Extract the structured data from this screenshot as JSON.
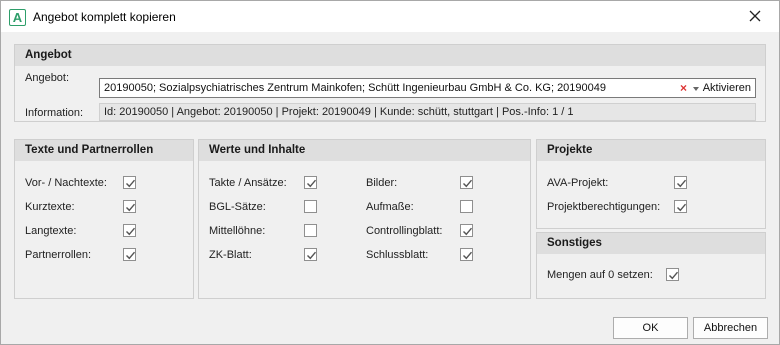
{
  "window": {
    "title": "Angebot komplett kopieren",
    "icon_letter": "A",
    "accent": "#2e9e6a"
  },
  "angebot": {
    "header": "Angebot",
    "angebot_label": "Angebot:",
    "angebot_value": "20190050; Sozialpsychiatrisches Zentrum Mainkofen; Schütt Ingenieurbau GmbH & Co. KG; 20190049",
    "activate_label": "Aktivieren",
    "information_label": "Information:",
    "information_value": "Id: 20190050 | Angebot: 20190050 | Projekt: 20190049 | Kunde: schütt, stuttgart | Pos.-Info: 1 / 1"
  },
  "texte": {
    "header": "Texte und Partnerrollen",
    "items": [
      {
        "label": "Vor- / Nachtexte:",
        "checked": true
      },
      {
        "label": "Kurztexte:",
        "checked": true
      },
      {
        "label": "Langtexte:",
        "checked": true
      },
      {
        "label": "Partnerrollen:",
        "checked": true
      }
    ]
  },
  "werte": {
    "header": "Werte und Inhalte",
    "left": [
      {
        "label": "Takte / Ansätze:",
        "checked": true
      },
      {
        "label": "BGL-Sätze:",
        "checked": false
      },
      {
        "label": "Mittellöhne:",
        "checked": false
      },
      {
        "label": "ZK-Blatt:",
        "checked": true
      }
    ],
    "right": [
      {
        "label": "Bilder:",
        "checked": true
      },
      {
        "label": "Aufmaße:",
        "checked": false
      },
      {
        "label": "Controllingblatt:",
        "checked": true
      },
      {
        "label": "Schlussblatt:",
        "checked": true
      }
    ]
  },
  "projekte": {
    "header": "Projekte",
    "items": [
      {
        "label": "AVA-Projekt:",
        "checked": true
      },
      {
        "label": "Projektberechtigungen:",
        "checked": true
      }
    ]
  },
  "sonstiges": {
    "header": "Sonstiges",
    "items": [
      {
        "label": "Mengen auf 0 setzen:",
        "checked": true
      }
    ]
  },
  "buttons": {
    "ok": "OK",
    "cancel": "Abbrechen"
  }
}
